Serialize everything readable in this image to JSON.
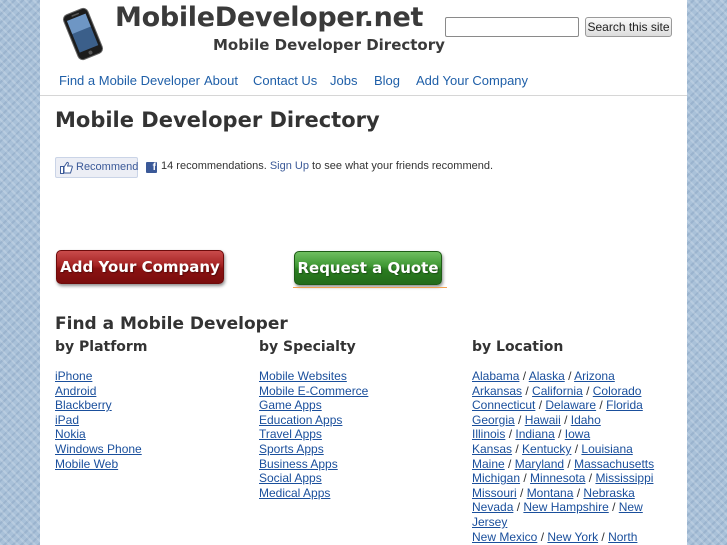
{
  "header": {
    "logo_title": "MobileDeveloper.net",
    "logo_tagline": "Mobile Developer Directory",
    "search_placeholder": "",
    "search_button": "Search this site"
  },
  "nav": [
    {
      "label": "Find a Mobile Developer"
    },
    {
      "label": "About"
    },
    {
      "label": "Contact Us"
    },
    {
      "label": "Jobs"
    },
    {
      "label": "Blog"
    },
    {
      "label": "Add Your Company"
    }
  ],
  "main": {
    "title": "Mobile Developer Directory",
    "recommend": {
      "button": "Recommend",
      "count_text": "14 recommendations.",
      "signup": "Sign Up",
      "suffix": "to see what your friends recommend."
    },
    "add_company_button": "Add Your Company",
    "request_quote_button": "Request a Quote",
    "find_heading": "Find a Mobile Developer"
  },
  "columns": {
    "platform": {
      "heading": "by Platform",
      "items": [
        "iPhone",
        "Android",
        "Blackberry",
        "iPad",
        "Nokia",
        "Windows Phone",
        "Mobile Web"
      ]
    },
    "specialty": {
      "heading": "by Specialty",
      "items": [
        "Mobile Websites",
        "Mobile E-Commerce",
        "Game Apps",
        "Education Apps",
        "Travel Apps",
        "Sports Apps",
        "Business Apps",
        "Social Apps",
        "Medical Apps"
      ]
    },
    "location": {
      "heading": "by Location",
      "lines": [
        [
          "Alabama",
          "Alaska",
          "Arizona"
        ],
        [
          "Arkansas",
          "California",
          "Colorado"
        ],
        [
          "Connecticut",
          "Delaware",
          "Florida"
        ],
        [
          "Georgia",
          "Hawaii",
          "Idaho"
        ],
        [
          "Illinois",
          "Indiana",
          "Iowa"
        ],
        [
          "Kansas",
          "Kentucky",
          "Louisiana"
        ],
        [
          "Maine",
          "Maryland",
          "Massachusetts"
        ],
        [
          "Michigan",
          "Minnesota",
          "Mississippi"
        ],
        [
          "Missouri",
          "Montana",
          "Nebraska"
        ],
        [
          "Nevada",
          "New Hampshire",
          "New"
        ],
        [
          "Jersey"
        ],
        [
          "New Mexico",
          "New York",
          "North"
        ]
      ]
    }
  },
  "colors": {
    "link": "#1a4f9c",
    "nav": "#1f5fa8",
    "add_company_red": "#a52323",
    "request_quote_green": "#3d9632",
    "facebook_blue": "#3b5998",
    "background": "#a9c1d9"
  },
  "icons": {
    "logo": "smartphone-icon",
    "recommend": "thumbs-up-icon",
    "facebook": "facebook-icon"
  }
}
